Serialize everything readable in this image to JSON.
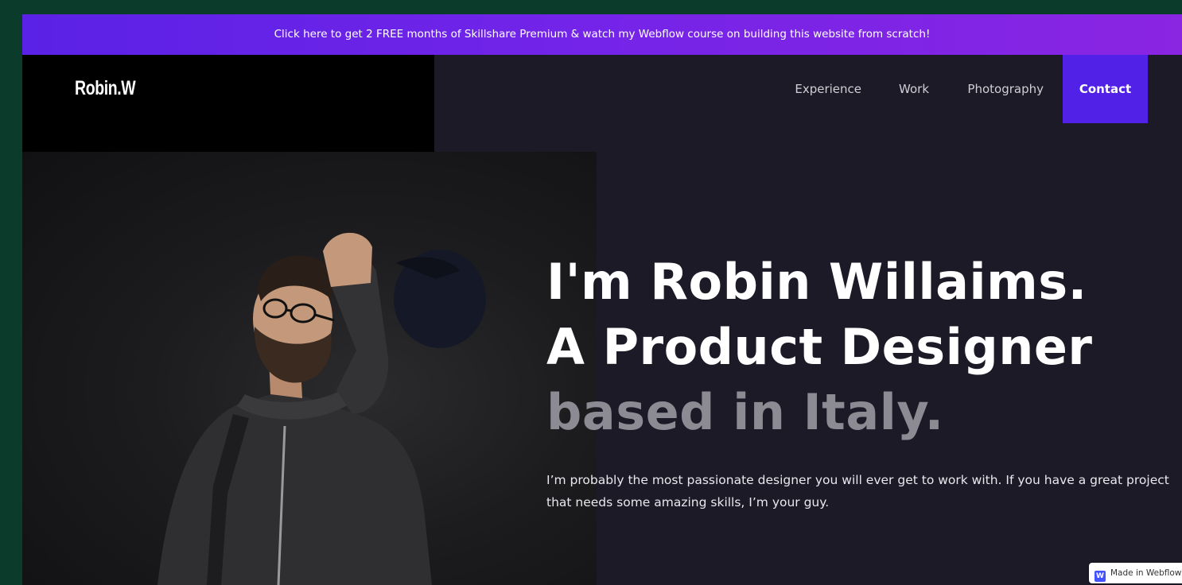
{
  "promo_banner": {
    "text": "Click here to get 2 FREE months of Skillshare Premium & watch my Webflow course on building this website from scratch!"
  },
  "header": {
    "logo": "Robin.W",
    "nav": {
      "experience": "Experience",
      "work": "Work",
      "photography": "Photography",
      "contact": "Contact"
    }
  },
  "hero": {
    "headline_line1": "I'm Robin Willaims.",
    "headline_line2": "A Product Designer",
    "headline_line3": "based in Italy.",
    "intro": "I’m probably the most passionate designer you will ever get to work with. If you have a great project that needs some amazing skills, I’m your guy."
  },
  "badge": {
    "icon_letter": "W",
    "label": "Made in Webflow"
  },
  "colors": {
    "promo_gradient_start": "#5a22e6",
    "promo_gradient_end": "#8a25e2",
    "page_background": "#1b1a26",
    "logo_block": "#000000",
    "contact_accent": "#5121e8",
    "headline_muted": "#8c8b93"
  },
  "icons": [
    "webflow-logo-icon"
  ]
}
